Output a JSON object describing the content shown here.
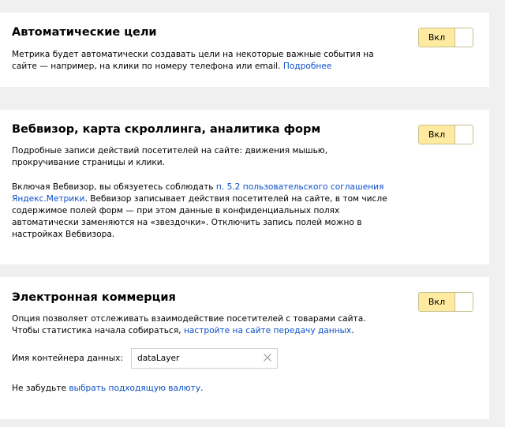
{
  "auto_goals": {
    "title": "Автоматические цели",
    "desc_line1": "Метрика будет автоматически создавать цели на некоторые важные события на",
    "desc_line2_text": "сайте — например, на клики по номеру телефона или email. ",
    "desc_link": "Подробнее",
    "toggle_label": "Вкл"
  },
  "webvisor": {
    "title": "Вебвизор, карта скроллинга, аналитика форм",
    "desc_p1_line1": "Подробные записи действий посетителей на сайте: движения мышью,",
    "desc_p1_line2": "прокручивание страницы и клики.",
    "desc_p2_prefix": "Включая Вебвизор, вы обязуетесь соблюдать ",
    "desc_p2_link_line1": "п. 5.2 пользовательского соглашения",
    "desc_p2_link_line2": "Яндекс.Метрики",
    "desc_p2_after_link": ". Вебвизор записывает действия посетителей на сайте, в том числе",
    "desc_p2_line3": "содержимое полей форм — при этом данные в конфиденциальных полях",
    "desc_p2_line4": "автоматически заменяются на «звездочки». Отключить запись полей можно в",
    "desc_p2_line5": "настройках Вебвизора.",
    "toggle_label": "Вкл"
  },
  "ecommerce": {
    "title": "Электронная коммерция",
    "desc_line1": "Опция позволяет отслеживать взаимодействие посетителей с товарами сайта.",
    "desc_line2_prefix": "Чтобы статистика начала собираться, ",
    "desc_line2_link": "настройте на сайте передачу данных",
    "desc_line2_suffix": ".",
    "container_label": "Имя контейнера данных:",
    "container_value": "dataLayer",
    "currency_prefix": "Не забудьте ",
    "currency_link": "выбрать подходящую валюту",
    "currency_suffix": ".",
    "toggle_label": "Вкл"
  },
  "colors": {
    "link": "#0b4fc9",
    "toggle_on_bg": "#ffeba0",
    "page_bg": "#f0f0f0"
  }
}
